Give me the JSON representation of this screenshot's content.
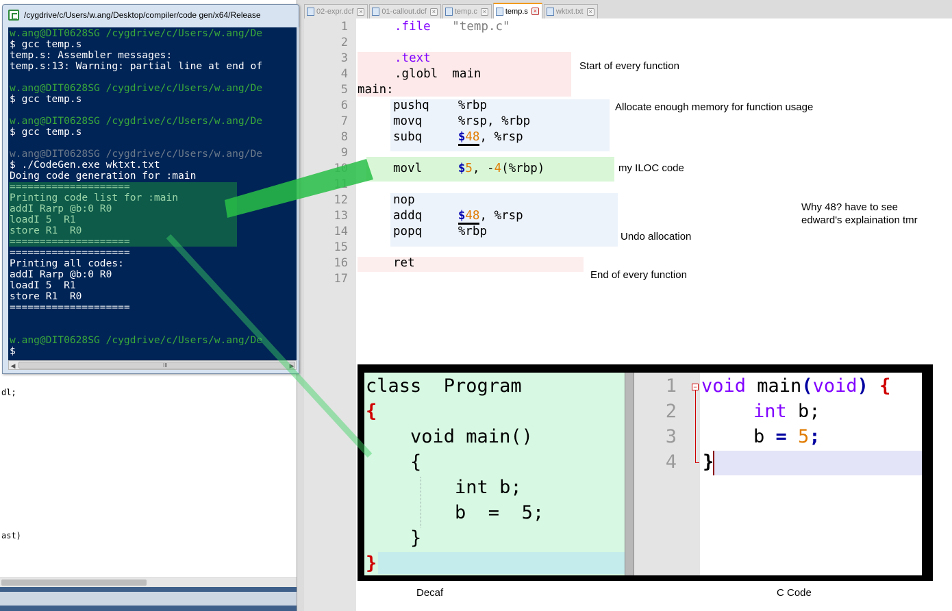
{
  "background": {
    "code_fragments": [
      "dl;",
      "ast)"
    ]
  },
  "terminal": {
    "title": "/cygdrive/c/Users/w.ang/Desktop/compiler/code gen/x64/Release",
    "lines": [
      {
        "text": "w.ang@DIT0628SG /cygdrive/c/Users/w.ang/De",
        "style": "g"
      },
      {
        "text": "$ gcc temp.s",
        "style": ""
      },
      {
        "text": "temp.s: Assembler messages:",
        "style": ""
      },
      {
        "text": "temp.s:13: Warning: partial line at end of",
        "style": ""
      },
      {
        "text": "",
        "style": ""
      },
      {
        "text": "w.ang@DIT0628SG /cygdrive/c/Users/w.ang/De",
        "style": "g"
      },
      {
        "text": "$ gcc temp.s",
        "style": ""
      },
      {
        "text": "",
        "style": ""
      },
      {
        "text": "w.ang@DIT0628SG /cygdrive/c/Users/w.ang/De",
        "style": "g"
      },
      {
        "text": "$ gcc temp.s",
        "style": ""
      },
      {
        "text": "",
        "style": ""
      },
      {
        "text": "w.ang@DIT0628SG /cygdrive/c/Users/w.ang/De",
        "style": "d"
      },
      {
        "text": "$ ./CodeGen.exe wktxt.txt",
        "style": ""
      },
      {
        "text": "Doing code generation for :main",
        "style": ""
      },
      {
        "text": "====================",
        "style": ""
      },
      {
        "text": "Printing code list for :main",
        "style": ""
      },
      {
        "text": "addI Rarp @b:0 R0",
        "style": ""
      },
      {
        "text": "loadI 5  R1",
        "style": ""
      },
      {
        "text": "store R1  R0",
        "style": ""
      },
      {
        "text": "====================",
        "style": ""
      },
      {
        "text": "====================",
        "style": ""
      },
      {
        "text": "Printing all codes:",
        "style": ""
      },
      {
        "text": "addI Rarp @b:0 R0",
        "style": ""
      },
      {
        "text": "loadI 5  R1",
        "style": ""
      },
      {
        "text": "store R1  R0",
        "style": ""
      },
      {
        "text": "====================",
        "style": ""
      },
      {
        "text": "",
        "style": ""
      },
      {
        "text": "",
        "style": ""
      },
      {
        "text": "w.ang@DIT0628SG /cygdrive/c/Users/w.ang/De",
        "style": "g"
      },
      {
        "text": "$",
        "style": ""
      }
    ],
    "scroll_grip": "III"
  },
  "editor": {
    "tabs": [
      {
        "label": "02-expr.dcf",
        "active": false
      },
      {
        "label": "01-callout.dcf",
        "active": false
      },
      {
        "label": "temp.c",
        "active": false
      },
      {
        "label": "temp.s",
        "active": true
      },
      {
        "label": "wktxt.txt",
        "active": false
      }
    ],
    "line_numbers": [
      "1",
      "2",
      "3",
      "4",
      "5",
      "6",
      "7",
      "8",
      "9",
      "10",
      "11",
      "12",
      "13",
      "14",
      "15",
      "16",
      "17"
    ],
    "asm": {
      "l1_dir": ".file",
      "l1_arg": "\"temp.c\"",
      "l3_dir": ".text",
      "l4_dir": ".globl",
      "l4_arg": "main",
      "l5_label": "main:",
      "l6_op": "pushq",
      "l6_arg": "%rbp",
      "l7_op": "movq",
      "l7_a": "%rsp,",
      "l7_b": "%rbp",
      "l8_op": "subq",
      "l8_dollar": "$",
      "l8_num": "48",
      "l8_comma": ",",
      "l8_reg": "%rsp",
      "l10_op": "movl",
      "l10_dollar": "$",
      "l10_num": "5",
      "l10_comma": ",",
      "l10_minus": "-",
      "l10_off": "4",
      "l10_reg": "(%rbp)",
      "l12_op": "nop",
      "l13_op": "addq",
      "l13_dollar": "$",
      "l13_num": "48",
      "l13_comma": ",",
      "l13_reg": "%rsp",
      "l14_op": "popq",
      "l14_arg": "%rbp",
      "l16_op": "ret"
    },
    "annotations": {
      "start": "Start of every function",
      "allocate": "Allocate enough memory for function usage",
      "iloc": "my ILOC code",
      "why_line1": "Why 48? have to see",
      "why_line2": "edward's explaination tmr",
      "undo": "Undo allocation",
      "end": "End of every function"
    },
    "colors": {
      "start_band": "#fde9e9",
      "alloc_band": "#edf3fb",
      "iloc_band": "#d9f7d6",
      "end_band": "#fde9e9",
      "tab_accent": "#f29b1d"
    }
  },
  "comparison": {
    "decaf": {
      "caption": "Decaf",
      "l1": "class  Program",
      "l2": "{",
      "l3": "    void main()",
      "l4": "    {",
      "l5": "        int b;",
      "l6": "        b  =  5;",
      "l7": "    }",
      "l8": "}"
    },
    "c": {
      "caption": "C Code",
      "line_numbers": [
        "1",
        "2",
        "3",
        "4"
      ],
      "void1": "void",
      "main": " main",
      "lp": "(",
      "void2": "void",
      "rp": ")",
      "ob": "{",
      "int": "int",
      "b_decl": " b;",
      "b": "b ",
      "eq": "=",
      "five": "5",
      "semi": ";",
      "cb": "}"
    }
  }
}
